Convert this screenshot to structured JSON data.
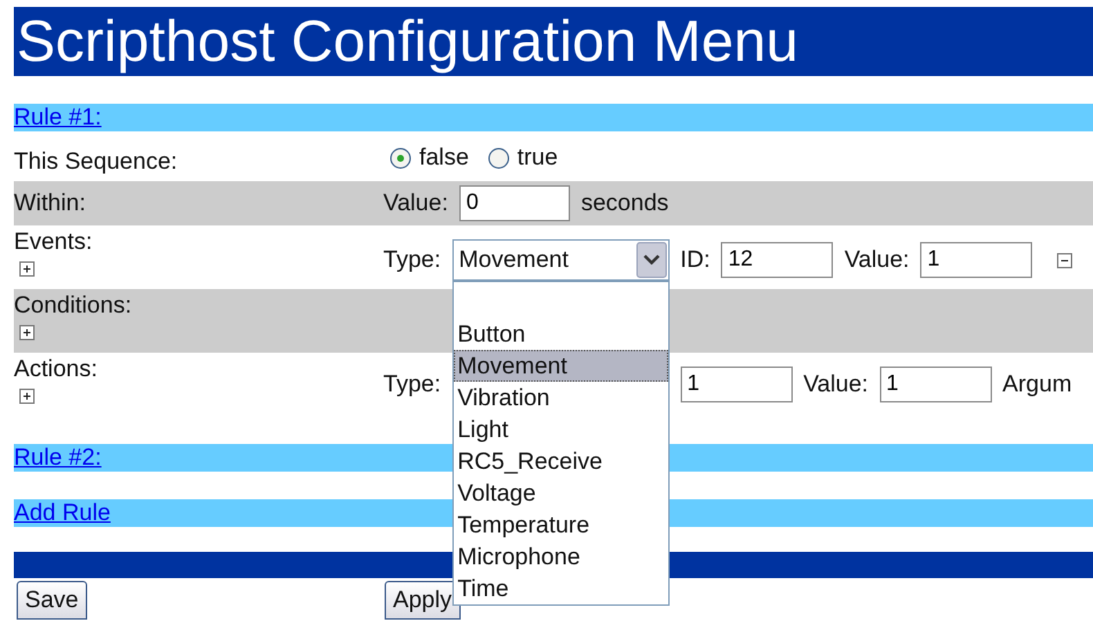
{
  "title": "Scripthost Configuration Menu",
  "rule_1": {
    "link": "Rule #1:",
    "sequence": {
      "label": "This Sequence:",
      "options": [
        {
          "label": "false",
          "selected": true
        },
        {
          "label": "true",
          "selected": false
        }
      ]
    },
    "within": {
      "label": "Within:",
      "value_label": "Value:",
      "value": "0",
      "unit": "seconds"
    },
    "events": {
      "label": "Events:",
      "type_label": "Type:",
      "type_value": "Movement",
      "id_label": "ID:",
      "id": "12",
      "value_label": "Value:",
      "value": "1"
    },
    "conditions": {
      "label": "Conditions:"
    },
    "actions": {
      "label": "Actions:",
      "type_label": "Type:",
      "id": "1",
      "value_label": "Value:",
      "value": "1",
      "argument_label": "Argum"
    }
  },
  "type_dropdown": {
    "options": [
      {
        "label": "Button",
        "selected": false
      },
      {
        "label": "Movement",
        "selected": true
      },
      {
        "label": "Vibration",
        "selected": false
      },
      {
        "label": "Light",
        "selected": false
      },
      {
        "label": "RC5_Receive",
        "selected": false
      },
      {
        "label": "Voltage",
        "selected": false
      },
      {
        "label": "Temperature",
        "selected": false
      },
      {
        "label": "Microphone",
        "selected": false
      },
      {
        "label": "Time",
        "selected": false
      }
    ]
  },
  "rule_2": {
    "link": "Rule #2:"
  },
  "add_rule": {
    "link": "Add Rule"
  },
  "buttons": [
    "Save",
    "Apply"
  ]
}
